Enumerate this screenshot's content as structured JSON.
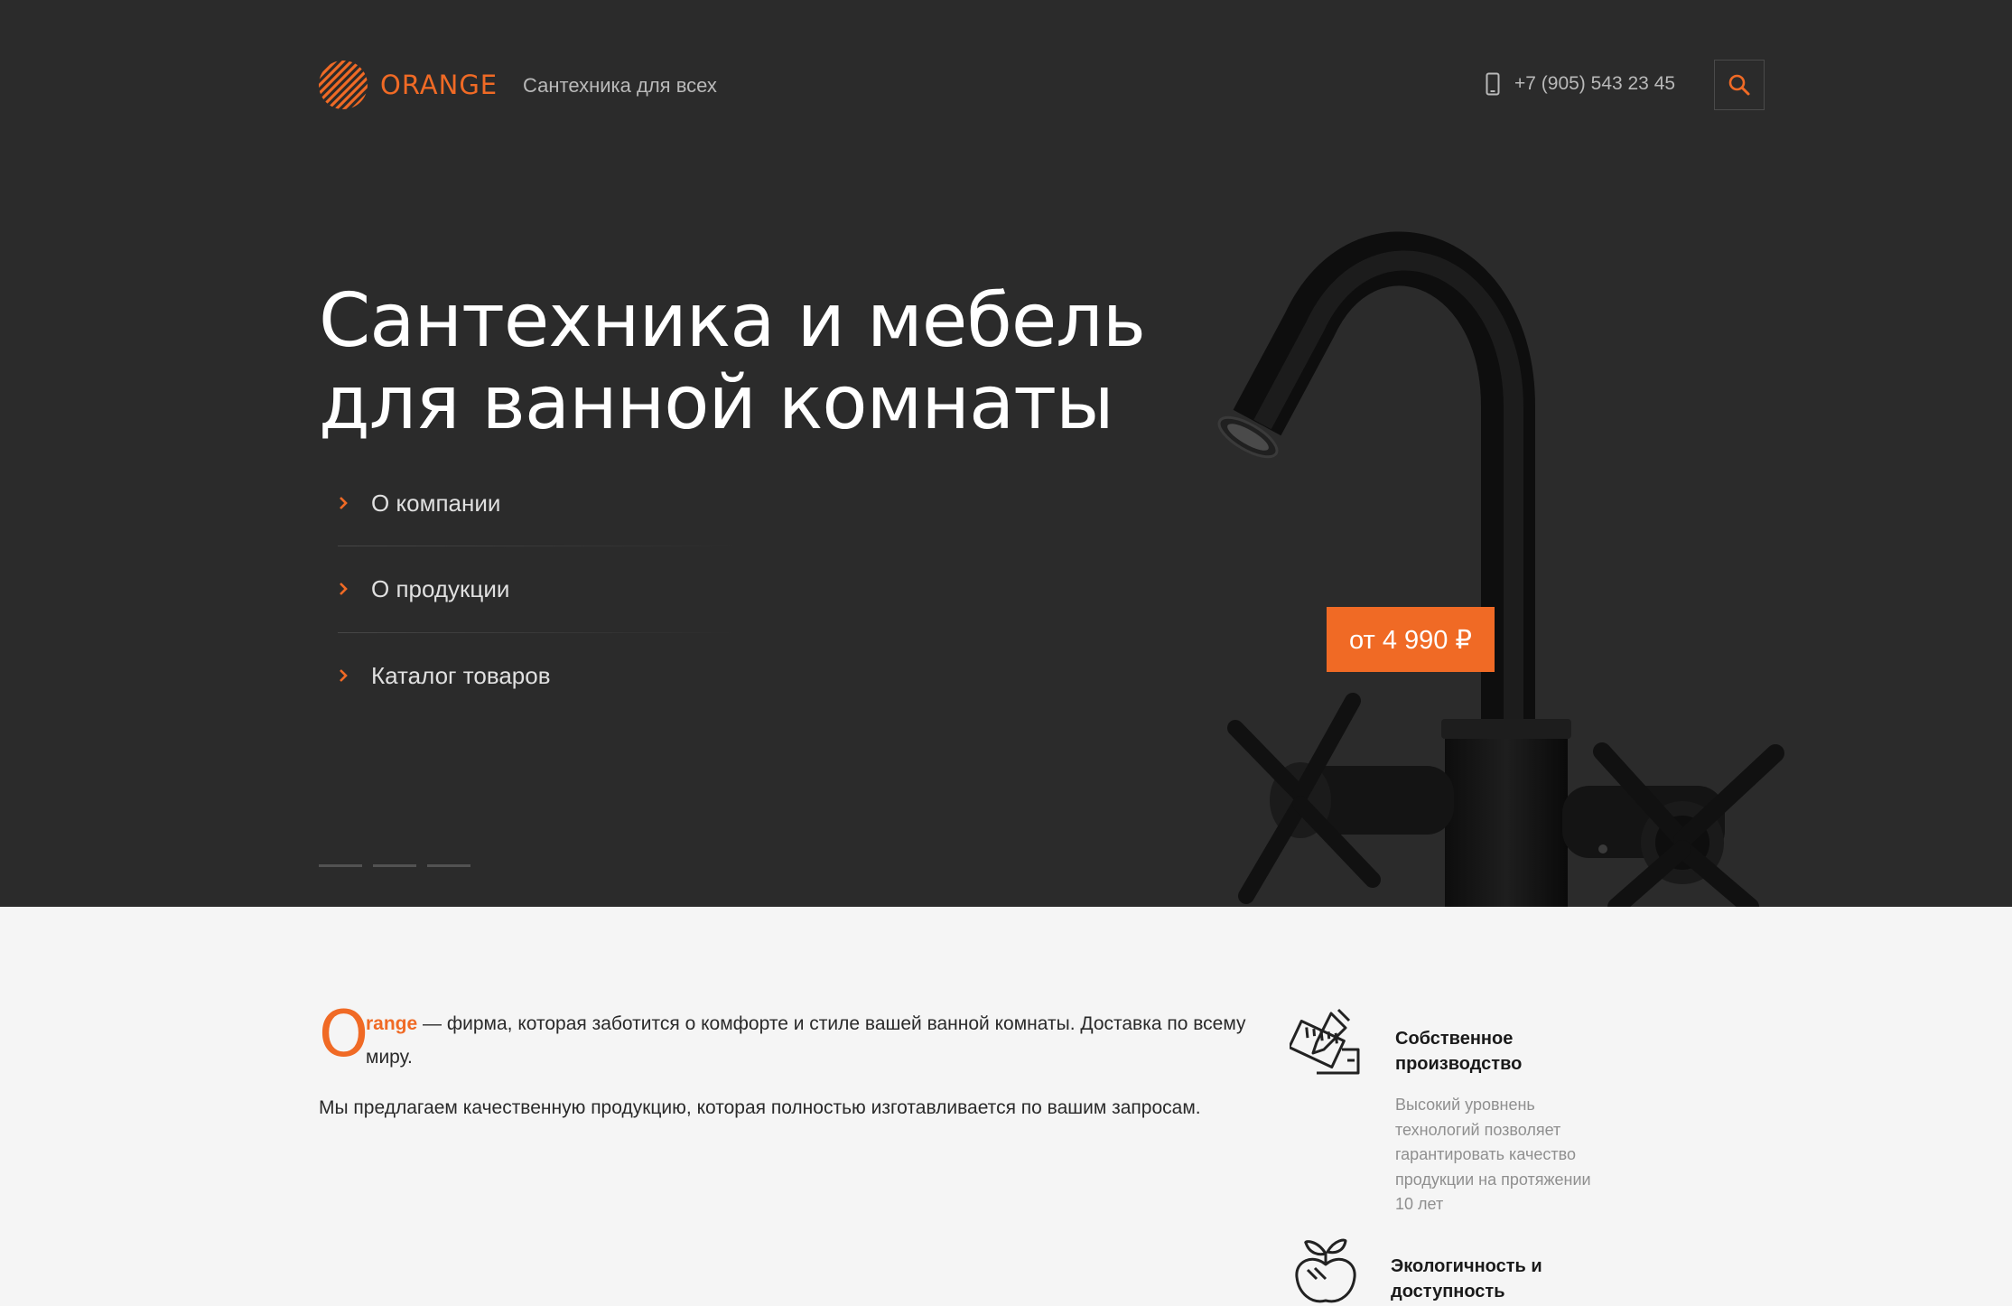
{
  "header": {
    "logo_text": "ORANGE",
    "tagline": "Сантехника для всех",
    "phone": "+7 (905) 543 23 45"
  },
  "hero": {
    "title_line1": "Сантехника и мебель",
    "title_line2": "для ванной комнаты",
    "menu": [
      {
        "label": "О компании"
      },
      {
        "label": "О продукции"
      },
      {
        "label": "Каталог товаров"
      }
    ],
    "price": "от 4 990 ₽",
    "slides_count": 3
  },
  "about": {
    "brand_initial": "O",
    "brand_rest": "range",
    "intro": " — фирма, которая заботится о комфорте и стиле вашей ванной комнаты. Доставка по всему миру.",
    "paragraph": "Мы предлагаем качественную продукцию, которая полностью изготавливается по вашим запросам."
  },
  "features": [
    {
      "icon": "ruler-pencil-icon",
      "title": "Собственное производство",
      "text": "Высокий уровнень технологий позволяет гарантировать качество продукции на протяжении 10 лет"
    },
    {
      "icon": "eco-apple-icon",
      "title": "Экологичность и доступность",
      "text": ""
    }
  ],
  "colors": {
    "accent": "#f06a25",
    "hero_bg": "#2b2b2b",
    "page_bg": "#f5f5f5"
  }
}
